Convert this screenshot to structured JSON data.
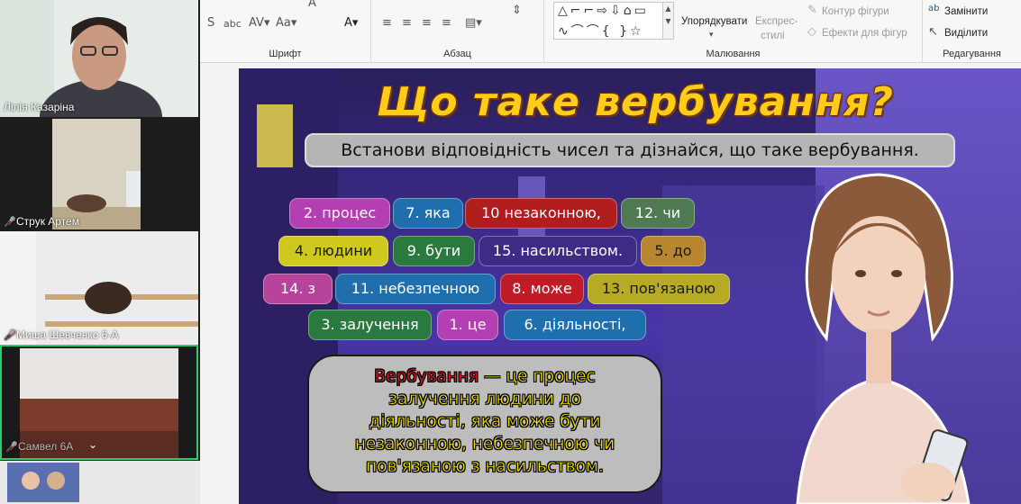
{
  "ribbon": {
    "font_group_label": "Шрифт",
    "paragraph_group_label": "Абзац",
    "drawing_group_label": "Малювання",
    "editing_group_label": "Редагування",
    "arrange_label": "Упорядкувати",
    "quick_styles_label_1": "Експрес-",
    "quick_styles_label_2": "стилі",
    "shape_outline_label": "Контур фігури",
    "shape_effects_label": "Ефекти для фігур",
    "replace_label": "Замінити",
    "select_label": "Виділити"
  },
  "participants": [
    {
      "name": "Лілія Казаріна",
      "muted": false
    },
    {
      "name": "Струк Артем",
      "muted": true
    },
    {
      "name": "Миша Шевченко 6-А",
      "muted": true
    },
    {
      "name": "Самвел 6А",
      "muted": true
    }
  ],
  "slide": {
    "title": "Що таке вербування?",
    "subtitle": "Встанови відповідність чисел та дізнайся, що таке вербування.",
    "chips": [
      "2. процес",
      "7. яка",
      "10 незаконною,",
      "12. чи",
      "4. людини",
      "9. бути",
      "15. насильством.",
      "5. до",
      "14. з",
      "11. небезпечною",
      "8. може",
      "13. пов'язаною",
      "3. залучення",
      "1. це",
      "6. діяльності,"
    ],
    "definition_keyword": "Вербування",
    "definition_lines": [
      " — це процес",
      "залучення людини до",
      "діяльності, яка може бути",
      "незаконною, небезпечною чи",
      "пов'язаною з насильством."
    ]
  },
  "colors": {
    "title": "#ffcc1a",
    "definition_text": "#ffe600",
    "definition_keyword": "#e11a1a",
    "active_speaker_border": "#2ecc71"
  }
}
